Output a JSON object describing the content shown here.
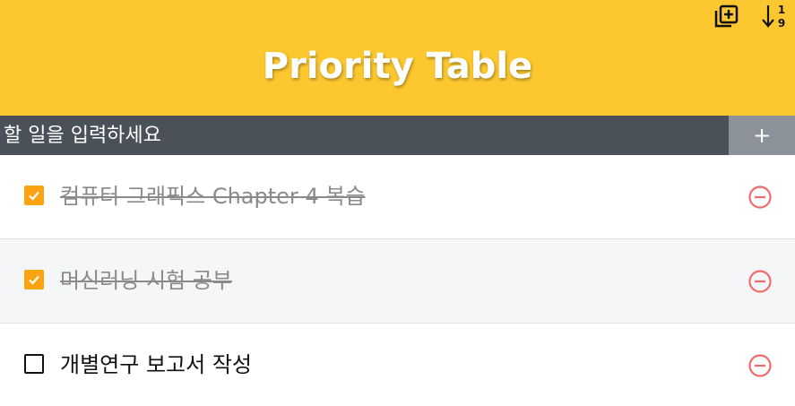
{
  "header": {
    "title": "Priority Table",
    "add_list_icon": "library-add-icon",
    "sort_icon": "sort-numeric-icon",
    "sort_digits": [
      "1",
      "9"
    ],
    "background": "#fdc82f"
  },
  "input": {
    "placeholder": "할 일을 입력하세요",
    "value": "",
    "add_label": "+"
  },
  "items": [
    {
      "text": "컴퓨터 그래픽스 Chapter 4 복습",
      "done": true
    },
    {
      "text": "머신러닝 시험 공부",
      "done": true
    },
    {
      "text": "개별연구 보고서 작성",
      "done": false
    }
  ],
  "colors": {
    "accent_check": "#fca311",
    "remove": "#f26b6b",
    "input_bar": "#4b5159",
    "add_button": "#8b9299"
  }
}
